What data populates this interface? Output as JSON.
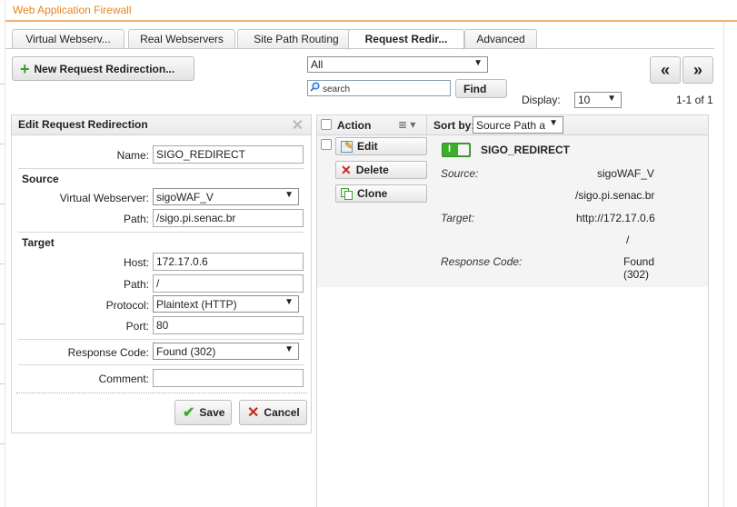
{
  "app": {
    "title": "Web Application Firewall"
  },
  "tabs": [
    {
      "label": "Virtual Webserv..."
    },
    {
      "label": "Real Webservers"
    },
    {
      "label": "Site Path Routing"
    },
    {
      "label": "Request Redir..."
    },
    {
      "label": "Advanced"
    }
  ],
  "toolbar": {
    "new_label": "New Request Redirection...",
    "filter_value": "All",
    "search_placeholder": "search",
    "find_label": "Find",
    "prev_label": "«",
    "next_label": "»",
    "display_label": "Display:",
    "display_value": "10",
    "pagination": "1-1 of 1"
  },
  "edit_panel": {
    "title": "Edit Request Redirection",
    "name_label": "Name:",
    "name_value": "SIGO_REDIRECT",
    "source_heading": "Source",
    "virtual_webserver_label": "Virtual Webserver:",
    "virtual_webserver_value": "sigoWAF_V",
    "source_path_label": "Path:",
    "source_path_value": "/sigo.pi.senac.br",
    "target_heading": "Target",
    "host_label": "Host:",
    "host_value": "172.17.0.6",
    "target_path_label": "Path:",
    "target_path_value": "/",
    "protocol_label": "Protocol:",
    "protocol_value": "Plaintext (HTTP)",
    "port_label": "Port:",
    "port_value": "80",
    "response_code_label": "Response Code:",
    "response_code_value": "Found (302)",
    "comment_label": "Comment:",
    "comment_value": "",
    "save_label": "Save",
    "cancel_label": "Cancel"
  },
  "list": {
    "action_header": "Action",
    "sort_by_label": "Sort by:",
    "sort_by_value": "Source Path a",
    "actions": {
      "edit": "Edit",
      "delete": "Delete",
      "clone": "Clone"
    },
    "item": {
      "name": "SIGO_REDIRECT",
      "enabled": true,
      "toggle_label": "I",
      "source_label": "Source:",
      "source_webserver": "sigoWAF_V",
      "source_path": "/sigo.pi.senac.br",
      "target_label": "Target:",
      "target_host": "http://172.17.0.6",
      "target_path": "/",
      "response_code_label": "Response Code:",
      "response_code_line1": "Found",
      "response_code_line2": "(302)"
    }
  },
  "colors": {
    "title_orange": "#e8841a",
    "toggle_green": "#3cae2c",
    "plus_green": "#3a9a2a",
    "delete_red": "#c9261f"
  }
}
